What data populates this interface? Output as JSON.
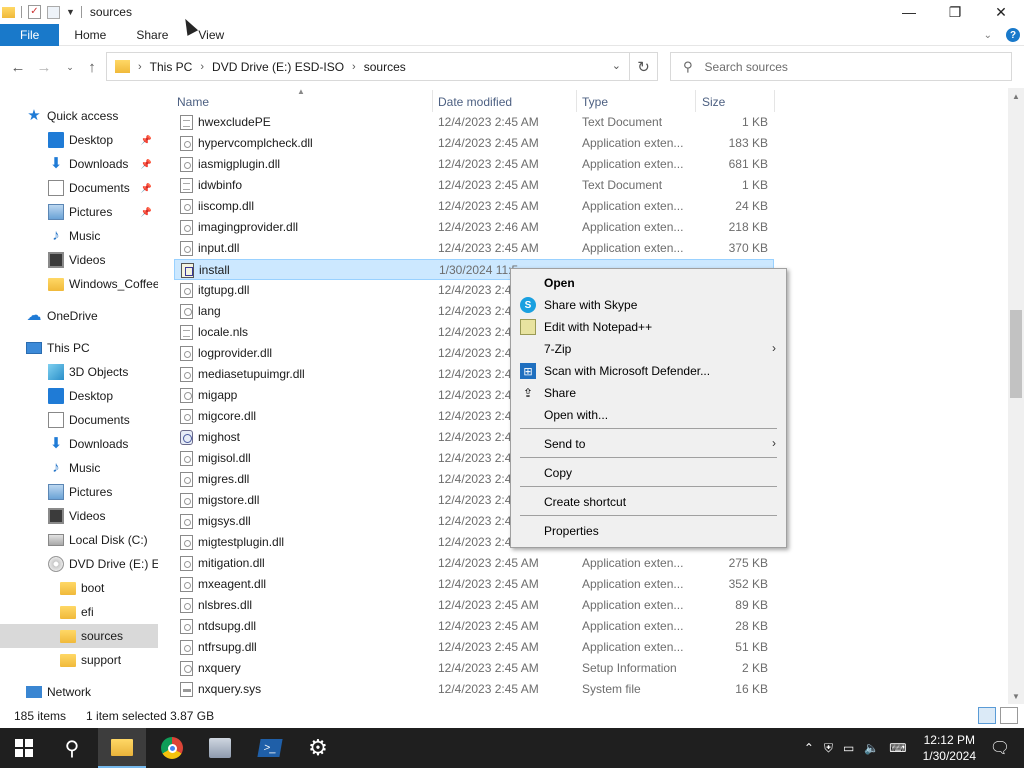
{
  "titlebar": {
    "title": "sources",
    "controls": {
      "minimize": "—",
      "maximize": "❐",
      "close": "✕"
    }
  },
  "ribbon": {
    "tabs": [
      "File",
      "Home",
      "Share",
      "View"
    ]
  },
  "address": {
    "crumbs": [
      "This PC",
      "DVD Drive (E:) ESD-ISO",
      "sources"
    ],
    "search_placeholder": "Search sources"
  },
  "nav": {
    "items": [
      {
        "label": "Quick access",
        "icon": "star-icon"
      },
      {
        "label": "Desktop",
        "icon": "desktop-icon",
        "pinned": true
      },
      {
        "label": "Downloads",
        "icon": "downloads-icon",
        "pinned": true
      },
      {
        "label": "Documents",
        "icon": "documents-icon",
        "pinned": true
      },
      {
        "label": "Pictures",
        "icon": "pictures-icon",
        "pinned": true
      },
      {
        "label": "Music",
        "icon": "music-icon"
      },
      {
        "label": "Videos",
        "icon": "videos-icon"
      },
      {
        "label": "Windows_Coffee_ec",
        "icon": "folder-icon"
      },
      {
        "label": "OneDrive",
        "icon": "onedrive-icon"
      },
      {
        "label": "This PC",
        "icon": "this-pc-icon"
      },
      {
        "label": "3D Objects",
        "icon": "3d-objects-icon"
      },
      {
        "label": "Desktop",
        "icon": "desktop-icon"
      },
      {
        "label": "Documents",
        "icon": "documents-icon"
      },
      {
        "label": "Downloads",
        "icon": "downloads-icon"
      },
      {
        "label": "Music",
        "icon": "music-icon"
      },
      {
        "label": "Pictures",
        "icon": "pictures-icon"
      },
      {
        "label": "Videos",
        "icon": "videos-icon"
      },
      {
        "label": "Local Disk (C:)",
        "icon": "local-disk-icon"
      },
      {
        "label": "DVD Drive (E:) ESD-I",
        "icon": "dvd-drive-icon"
      },
      {
        "label": "boot",
        "icon": "folder-icon"
      },
      {
        "label": "efi",
        "icon": "folder-icon"
      },
      {
        "label": "sources",
        "icon": "folder-icon",
        "selected": true
      },
      {
        "label": "support",
        "icon": "folder-icon"
      },
      {
        "label": "Network",
        "icon": "network-icon"
      }
    ]
  },
  "columns": {
    "name": "Name",
    "date": "Date modified",
    "type": "Type",
    "size": "Size"
  },
  "files": [
    {
      "name": "hwexcludePE",
      "date": "12/4/2023 2:45 AM",
      "type": "Text Document",
      "size": "1 KB",
      "kind": "txt"
    },
    {
      "name": "hypervcomplcheck.dll",
      "date": "12/4/2023 2:45 AM",
      "type": "Application exten...",
      "size": "183 KB",
      "kind": "dll"
    },
    {
      "name": "iasmigplugin.dll",
      "date": "12/4/2023 2:45 AM",
      "type": "Application exten...",
      "size": "681 KB",
      "kind": "dll"
    },
    {
      "name": "idwbinfo",
      "date": "12/4/2023 2:45 AM",
      "type": "Text Document",
      "size": "1 KB",
      "kind": "txt"
    },
    {
      "name": "iiscomp.dll",
      "date": "12/4/2023 2:45 AM",
      "type": "Application exten...",
      "size": "24 KB",
      "kind": "dll"
    },
    {
      "name": "imagingprovider.dll",
      "date": "12/4/2023 2:46 AM",
      "type": "Application exten...",
      "size": "218 KB",
      "kind": "dll"
    },
    {
      "name": "input.dll",
      "date": "12/4/2023 2:45 AM",
      "type": "Application exten...",
      "size": "370 KB",
      "kind": "dll"
    },
    {
      "name": "install",
      "date": "1/30/2024 11:5",
      "type": "",
      "size": "",
      "kind": "wim",
      "selected": true
    },
    {
      "name": "itgtupg.dll",
      "date": "12/4/2023 2:4",
      "type": "",
      "size": "",
      "kind": "dll"
    },
    {
      "name": "lang",
      "date": "12/4/2023 2:4",
      "type": "",
      "size": "",
      "kind": "inf"
    },
    {
      "name": "locale.nls",
      "date": "12/4/2023 2:4",
      "type": "",
      "size": "",
      "kind": "txt"
    },
    {
      "name": "logprovider.dll",
      "date": "12/4/2023 2:4",
      "type": "",
      "size": "",
      "kind": "dll"
    },
    {
      "name": "mediasetupuimgr.dll",
      "date": "12/4/2023 2:4",
      "type": "",
      "size": "",
      "kind": "dll"
    },
    {
      "name": "migapp",
      "date": "12/4/2023 2:4",
      "type": "",
      "size": "",
      "kind": "inf"
    },
    {
      "name": "migcore.dll",
      "date": "12/4/2023 2:4",
      "type": "",
      "size": "",
      "kind": "dll"
    },
    {
      "name": "mighost",
      "date": "12/4/2023 2:4",
      "type": "",
      "size": "",
      "kind": "exe"
    },
    {
      "name": "migisol.dll",
      "date": "12/4/2023 2:4",
      "type": "",
      "size": "",
      "kind": "dll"
    },
    {
      "name": "migres.dll",
      "date": "12/4/2023 2:4",
      "type": "",
      "size": "",
      "kind": "dll"
    },
    {
      "name": "migstore.dll",
      "date": "12/4/2023 2:4",
      "type": "",
      "size": "",
      "kind": "dll"
    },
    {
      "name": "migsys.dll",
      "date": "12/4/2023 2:4",
      "type": "",
      "size": "",
      "kind": "dll"
    },
    {
      "name": "migtestplugin.dll",
      "date": "12/4/2023 2:4",
      "type": "",
      "size": "",
      "kind": "dll"
    },
    {
      "name": "mitigation.dll",
      "date": "12/4/2023 2:45 AM",
      "type": "Application exten...",
      "size": "275 KB",
      "kind": "dll"
    },
    {
      "name": "mxeagent.dll",
      "date": "12/4/2023 2:45 AM",
      "type": "Application exten...",
      "size": "352 KB",
      "kind": "dll"
    },
    {
      "name": "nlsbres.dll",
      "date": "12/4/2023 2:45 AM",
      "type": "Application exten...",
      "size": "89 KB",
      "kind": "dll"
    },
    {
      "name": "ntdsupg.dll",
      "date": "12/4/2023 2:45 AM",
      "type": "Application exten...",
      "size": "28 KB",
      "kind": "dll"
    },
    {
      "name": "ntfrsupg.dll",
      "date": "12/4/2023 2:45 AM",
      "type": "Application exten...",
      "size": "51 KB",
      "kind": "dll"
    },
    {
      "name": "nxquery",
      "date": "12/4/2023 2:45 AM",
      "type": "Setup Information",
      "size": "2 KB",
      "kind": "inf"
    },
    {
      "name": "nxquery.sys",
      "date": "12/4/2023 2:45 AM",
      "type": "System file",
      "size": "16 KB",
      "kind": "sys"
    }
  ],
  "context_menu": [
    {
      "label": "Open",
      "bold": true,
      "icon": ""
    },
    {
      "label": "Share with Skype",
      "icon": "skype-icon"
    },
    {
      "label": "Edit with Notepad++",
      "icon": "notepadpp-icon"
    },
    {
      "label": "7-Zip",
      "submenu": true,
      "icon": ""
    },
    {
      "label": "Scan with Microsoft Defender...",
      "icon": "defender-icon"
    },
    {
      "label": "Share",
      "icon": "share-icon"
    },
    {
      "label": "Open with...",
      "icon": ""
    },
    {
      "sep": true
    },
    {
      "label": "Send to",
      "submenu": true,
      "icon": ""
    },
    {
      "sep": true
    },
    {
      "label": "Copy",
      "icon": ""
    },
    {
      "sep": true
    },
    {
      "label": "Create shortcut",
      "icon": ""
    },
    {
      "sep": true
    },
    {
      "label": "Properties",
      "icon": ""
    }
  ],
  "status": {
    "count": "185 items",
    "selection": "1 item selected  3.87 GB"
  },
  "taskbar": {
    "clock_time": "12:12 PM",
    "clock_date": "1/30/2024"
  },
  "colors": {
    "accent": "#1979ca",
    "selection": "#cce8ff",
    "taskbar": "#1f1f1f"
  }
}
